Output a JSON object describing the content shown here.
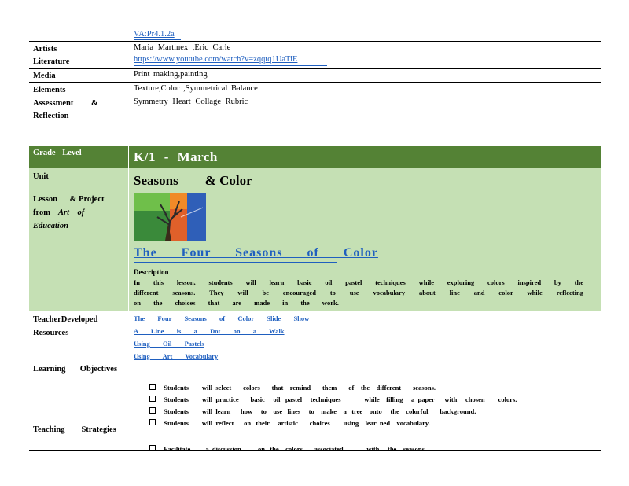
{
  "top": {
    "standard_link": "VA:Pr4.1.2a",
    "artists_label": "Artists",
    "literature_label": "Literature",
    "artists_value": "Maria   Martinex   ,Eric  Carle",
    "literature_link": "https://www.youtube.com/watch?v=zqqtq1UaTiE",
    "media_label": "Media",
    "media_value": "Print  making,painting",
    "elements_label": "Elements",
    "elements_value": "Texture,Color      ,Symmetrical      Balance",
    "assessment_label": "Assessment",
    "assessment_amp": "&",
    "reflection_label": "Reflection",
    "assessment_value": "Symmetry    Heart    Collage    Rubric"
  },
  "lesson": {
    "grade_label": "Grade      Level",
    "grade_value": "K/1   - March",
    "unit_label": "Unit",
    "unit_title": "Seasons        & Color",
    "lesson_label_1": "Lesson      & Project",
    "lesson_label_2_a": "from",
    "lesson_label_2_b": "Art    of",
    "lesson_label_3": "Education",
    "lesson_title": "The Four Seasons of Color",
    "description_heading": "Description",
    "description_text": "In this lesson, students will learn basic oil pastel techniques while exploring colors inspired by the different seasons. They will be encouraged to use vocabulary about line and color while reflecting on the choices that are made in the work."
  },
  "resources": {
    "label_1": "TeacherDeveloped",
    "label_2": "Resources",
    "links": [
      "The  Four  Seasons  of  Color  Slide  Show",
      "A  Line  is  a  Dot  on  a  Walk",
      "Using  Oil  Pastels",
      "Using  Art  Vocabulary"
    ]
  },
  "objectives": {
    "label": "Learning       Objectives",
    "items": [
      "Students        will  select       colors       that    remind       them       of    the    different       seasons.",
      "Students        will  practice       basic     oil   pastel     techniques              while    filling     a  paper      with     chosen        colors.",
      "Students        will  learn      how     to    use   lines     to    make    a   tree    onto     the    colorful       background.",
      "Students        will  reflect      on   their     artistic       choices        using    lear  ned    vocabulary."
    ]
  },
  "strategies": {
    "label": "Teaching        Strategies",
    "items": [
      "Facilitate         a  discussion          on   the    colors       associated              with     the    seasons."
    ]
  },
  "colors": {
    "band_dark": "#548235",
    "band_light": "#c5e0b4",
    "link": "#1f5fbf"
  }
}
